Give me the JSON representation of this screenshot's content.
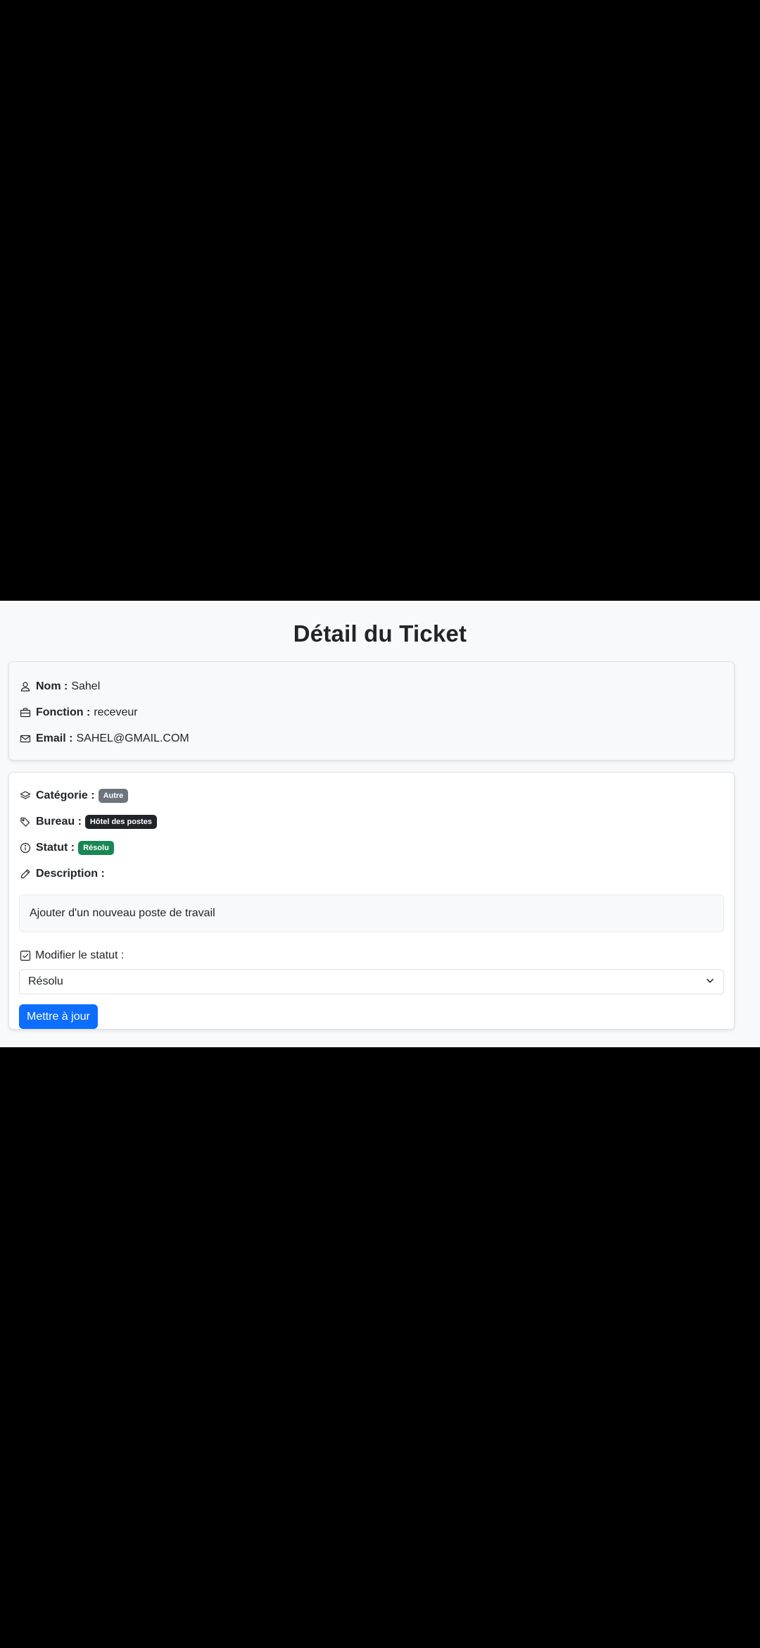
{
  "page": {
    "title": "Détail du Ticket"
  },
  "user": {
    "name_label": "Nom :",
    "name_value": "Sahel",
    "function_label": "Fonction :",
    "function_value": "receveur",
    "email_label": "Email :",
    "email_value": "SAHEL@GMAIL.COM"
  },
  "ticket": {
    "category_label": "Catégorie :",
    "category_value": "Autre",
    "office_label": "Bureau :",
    "office_value": "Hôtel des postes",
    "status_label": "Statut :",
    "status_value": "Résolu",
    "description_label": "Description :",
    "description_value": "Ajouter d'un nouveau poste de travail"
  },
  "form": {
    "modify_status_label": "Modifier le statut :",
    "selected_status": "Résolu",
    "submit_label": "Mettre à jour"
  },
  "colors": {
    "category_badge": "#6c757d",
    "office_badge": "#212529",
    "status_badge": "#198754",
    "primary_button": "#0d6efd"
  },
  "icons": {
    "name": "person-icon",
    "function": "briefcase-icon",
    "email": "envelope-icon",
    "category": "layers-icon",
    "office": "tags-icon",
    "status": "info-circle-icon",
    "description": "pencil-icon",
    "modify_status": "check-square-icon",
    "select": "chevron-down-icon"
  }
}
